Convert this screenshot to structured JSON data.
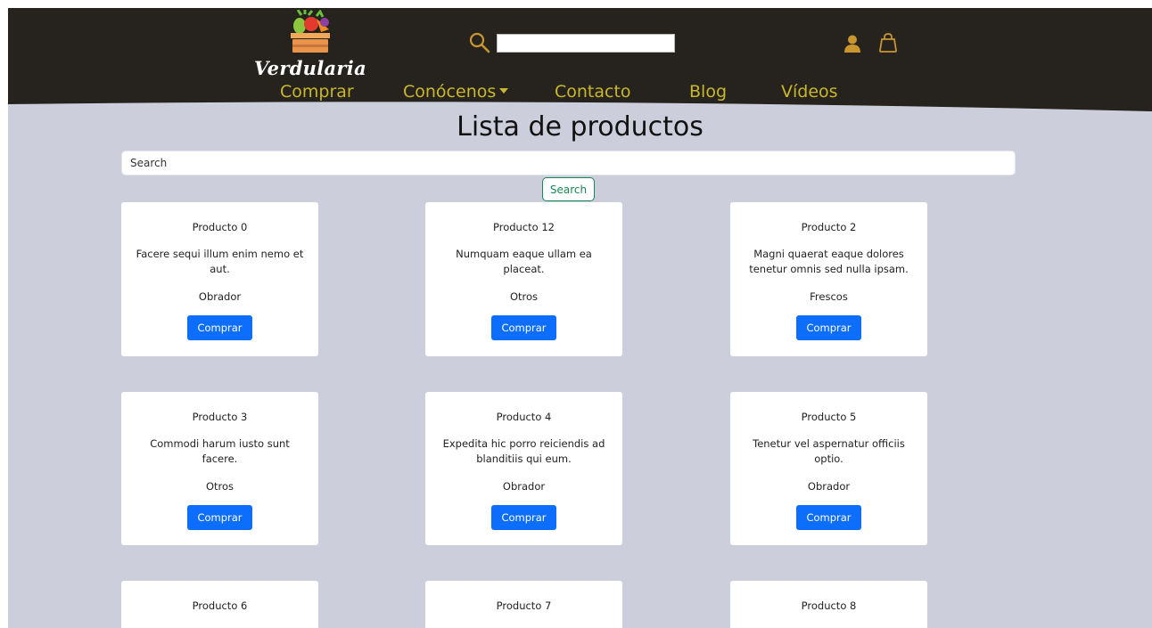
{
  "brand": {
    "name": "Verdularia"
  },
  "header": {
    "search_placeholder": "",
    "nav": [
      {
        "label": "Comprar"
      },
      {
        "label": "Conócenos"
      },
      {
        "label": "Contacto"
      },
      {
        "label": "Blog"
      },
      {
        "label": "Vídeos"
      }
    ]
  },
  "page": {
    "title": "Lista de productos",
    "search_placeholder": "Search",
    "search_button": "Search"
  },
  "products": [
    {
      "name": "Producto 0",
      "description": "Facere sequi illum enim nemo et aut.",
      "category": "Obrador",
      "button": "Comprar"
    },
    {
      "name": "Producto 12",
      "description": "Numquam eaque ullam ea placeat.",
      "category": "Otros",
      "button": "Comprar"
    },
    {
      "name": "Producto 2",
      "description": "Magni quaerat eaque dolores tenetur omnis sed nulla ipsam.",
      "category": "Frescos",
      "button": "Comprar"
    },
    {
      "name": "Producto 3",
      "description": "Commodi harum iusto sunt facere.",
      "category": "Otros",
      "button": "Comprar"
    },
    {
      "name": "Producto 4",
      "description": "Expedita hic porro reiciendis ad blanditiis qui eum.",
      "category": "Obrador",
      "button": "Comprar"
    },
    {
      "name": "Producto 5",
      "description": "Tenetur vel aspernatur officiis optio.",
      "category": "Obrador",
      "button": "Comprar"
    },
    {
      "name": "Producto 6",
      "description": "",
      "category": "",
      "button": ""
    },
    {
      "name": "Producto 7",
      "description": "",
      "category": "",
      "button": ""
    },
    {
      "name": "Producto 8",
      "description": "",
      "category": "",
      "button": ""
    }
  ],
  "colors": {
    "header_bg": "#26221d",
    "nav_text": "#c9b82a",
    "icon_accent": "#c9962f",
    "page_bg": "#cccfdb",
    "buy_button": "#0d6efd",
    "search_button_border": "#198754"
  },
  "icons": {
    "logo": "vegetable-crate-icon",
    "search": "magnifier-icon",
    "user": "user-icon",
    "cart": "shopping-bag-icon",
    "dropdown": "caret-down-icon"
  }
}
